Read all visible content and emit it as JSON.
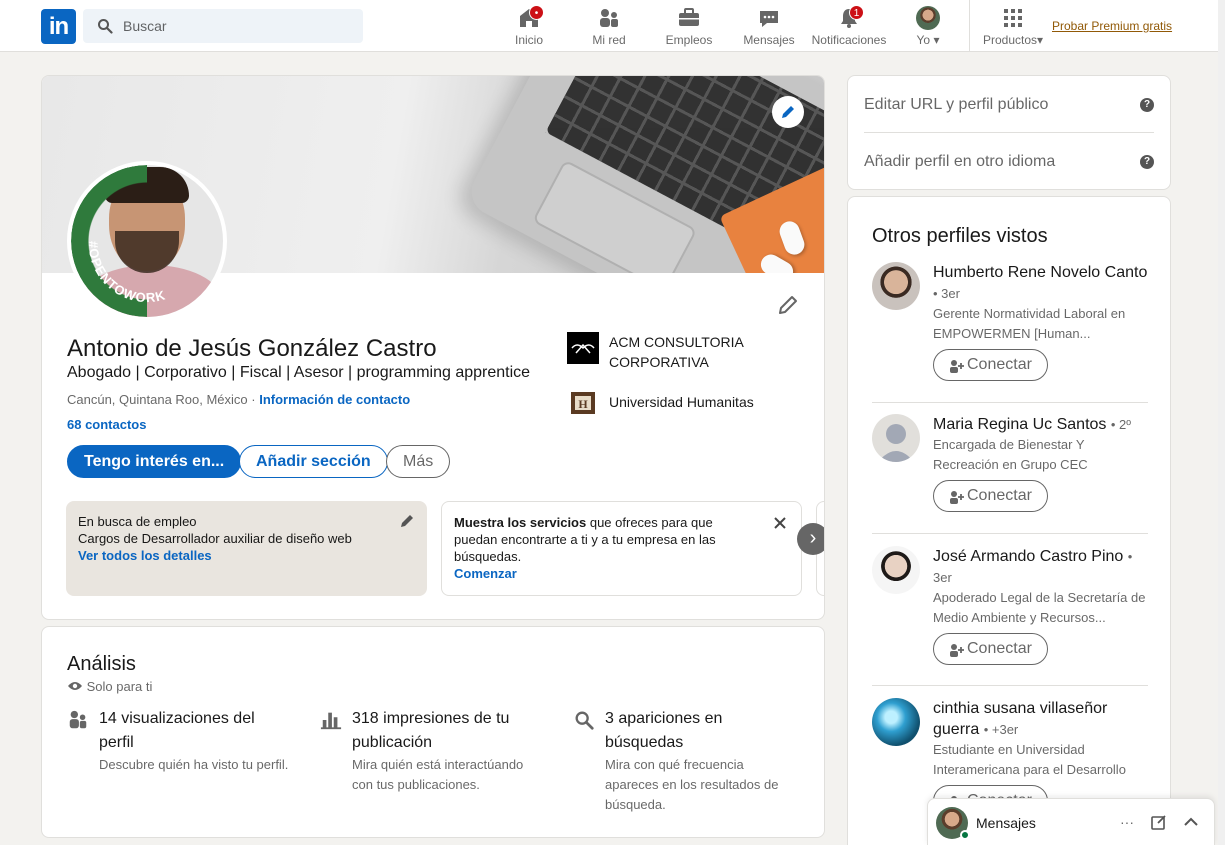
{
  "search": {
    "placeholder": "Buscar"
  },
  "nav": {
    "items": [
      {
        "label": "Inicio",
        "icon": "home-icon",
        "badge": ""
      },
      {
        "label": "Mi red",
        "icon": "network-icon",
        "badge": ""
      },
      {
        "label": "Empleos",
        "icon": "briefcase-icon",
        "badge": ""
      },
      {
        "label": "Mensajes",
        "icon": "chat-icon",
        "badge": ""
      },
      {
        "label": "Notificaciones",
        "icon": "bell-icon",
        "badge": "1"
      }
    ],
    "me_label": "Yo",
    "products_label": "Productos",
    "premium_label": "Probar Premium gratis"
  },
  "profile": {
    "name": "Antonio de Jesús González Castro",
    "headline": "Abogado | Corporativo | Fiscal | Asesor | programming apprentice",
    "location": "Cancún, Quintana Roo, México",
    "location_sep": " · ",
    "contact_info": "Información de contacto",
    "connections": "68 contactos",
    "open_to_work_badge": "#OPENTOWORK",
    "buttons": {
      "primary": "Tengo interés en...",
      "add_section": "Añadir sección",
      "more": "Más"
    },
    "orgs": [
      {
        "name": "ACM CONSULTORIA CORPORATIVA",
        "logo": "acm-logo-icon"
      },
      {
        "name": "Universidad Humanitas",
        "logo": "university-logo-icon"
      }
    ],
    "job_tile": {
      "title": "En busca de empleo",
      "description": "Cargos de Desarrollador auxiliar de diseño web",
      "link": "Ver todos los detalles"
    },
    "services_tile": {
      "bold": "Muestra los servicios",
      "text": " que ofreces para que puedan encontrarte a ti y a tu empresa en las búsquedas.",
      "link": "Comenzar"
    }
  },
  "analytics": {
    "title": "Análisis",
    "subtitle": "Solo para ti",
    "items": [
      {
        "title": "14 visualizaciones del perfil",
        "description": "Descubre quién ha visto tu perfil.",
        "icon": "people-icon"
      },
      {
        "title": "318 impresiones de tu publicación",
        "description": "Mira quién está interactúando con tus publicaciones.",
        "icon": "bar-chart-icon"
      },
      {
        "title": "3 apariciones en búsquedas",
        "description": "Mira con qué frecuencia apareces en los resultados de búsqueda.",
        "icon": "search-icon"
      }
    ]
  },
  "sidebar": {
    "edit_url": "Editar URL y perfil público",
    "add_language": "Añadir perfil en otro idioma",
    "help_glyph": "?",
    "others_title": "Otros perfiles vistos",
    "connect_label": "Conectar",
    "people": [
      {
        "name": "Humberto Rene Novelo Canto",
        "degree": "• 3er",
        "description": "Gerente Normatividad Laboral en EMPOWERMEN [Human..."
      },
      {
        "name": "Maria Regina Uc Santos",
        "degree": "• 2º",
        "description": "Encargada de Bienestar Y Recreación en Grupo CEC"
      },
      {
        "name": "José Armando Castro Pino",
        "degree": "• 3er",
        "description": "Apoderado Legal de la Secretaría de Medio Ambiente y Recursos..."
      },
      {
        "name": "cinthia susana villaseñor guerra",
        "degree": "• +3er",
        "description": "Estudiante en Universidad Interamericana para el Desarrollo"
      }
    ]
  },
  "messaging": {
    "label": "Mensajes"
  },
  "colors": {
    "brand": "#0a66c2",
    "badge": "#cc1016",
    "premium": "#915907",
    "online": "#057642"
  }
}
